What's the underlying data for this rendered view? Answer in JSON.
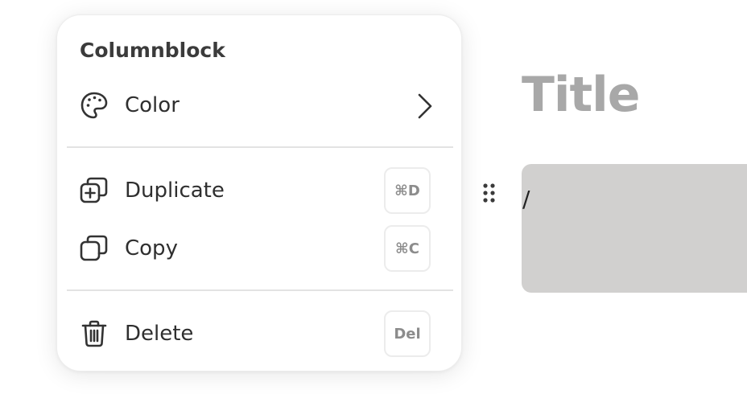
{
  "editor": {
    "title": "Title",
    "block_text": "/",
    "block_color": "#d1d0cf"
  },
  "menu": {
    "header": "Columnblock",
    "items": [
      {
        "label": "Color",
        "icon": "palette-icon",
        "trailing": "chevron-right-icon"
      },
      {
        "label": "Duplicate",
        "icon": "duplicate-icon",
        "shortcut": "⌘D"
      },
      {
        "label": "Copy",
        "icon": "copy-icon",
        "shortcut": "⌘C"
      },
      {
        "label": "Delete",
        "icon": "trash-icon",
        "shortcut": "Del"
      }
    ]
  }
}
